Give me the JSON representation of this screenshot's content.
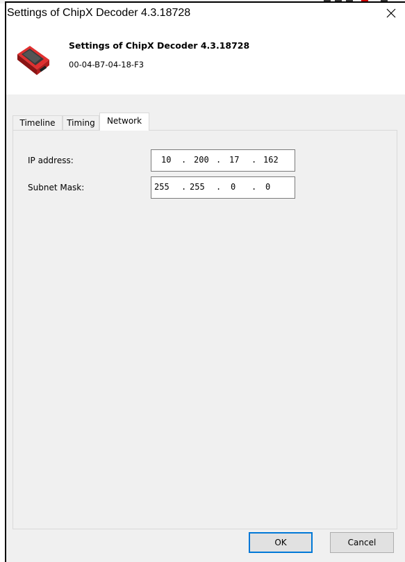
{
  "window": {
    "title": "Settings of ChipX Decoder 4.3.18728"
  },
  "header": {
    "title": "Settings of ChipX Decoder 4.3.18728",
    "mac": "00-04-B7-04-18-F3",
    "icon": "usb-device-icon"
  },
  "tabs": [
    {
      "label": "Timeline",
      "active": false
    },
    {
      "label": "Timing",
      "active": false
    },
    {
      "label": "Network",
      "active": true
    }
  ],
  "network": {
    "ip_label": "IP address:",
    "ip_octets": [
      "10",
      "200",
      "17",
      "162"
    ],
    "mask_label": "Subnet Mask:",
    "mask_octets": [
      "255",
      "255",
      "0",
      "0"
    ],
    "separator": "."
  },
  "buttons": {
    "ok": "OK",
    "cancel": "Cancel"
  },
  "colors": {
    "body_bg": "#f0f0f0",
    "accent": "#0078d7",
    "device_red": "#d42a2a"
  }
}
